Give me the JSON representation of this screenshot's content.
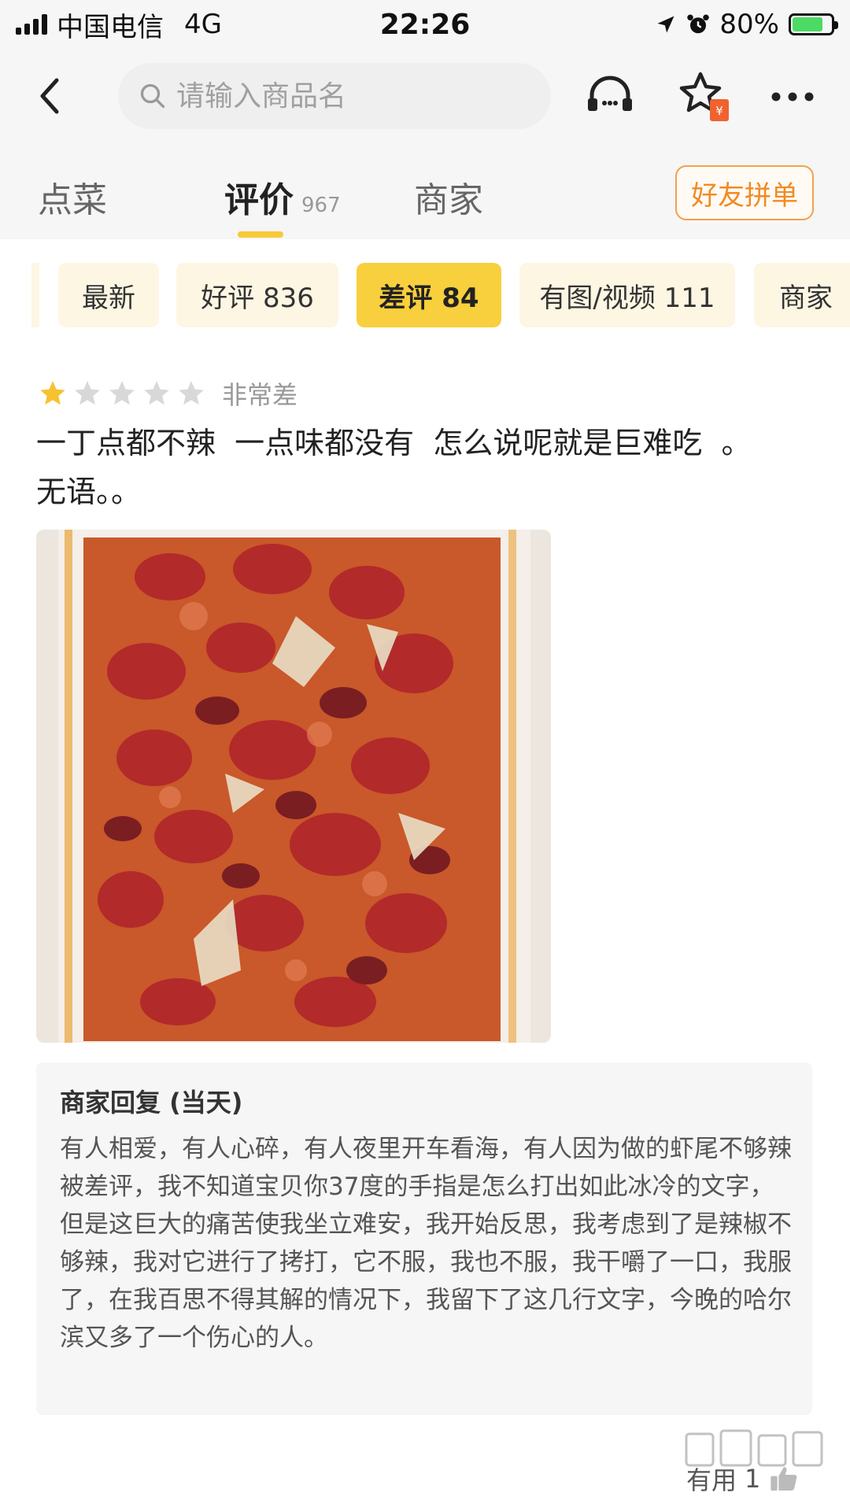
{
  "status_bar": {
    "carrier": "中国电信",
    "network": "4G",
    "time": "22:26",
    "battery": "80%"
  },
  "header": {
    "search_placeholder": "请输入商品名",
    "icons": [
      "back-arrow-icon",
      "search-icon",
      "customer-service-icon",
      "star-coupon-icon",
      "more-icon"
    ]
  },
  "tabs": {
    "order": "点菜",
    "reviews": "评价",
    "reviews_count": "967",
    "merchant": "商家",
    "group_order": "好友拼单"
  },
  "filters": [
    {
      "label": "最新"
    },
    {
      "label": "好评 836"
    },
    {
      "label": "差评 84"
    },
    {
      "label": "有图/视频 111"
    },
    {
      "label": "商家"
    }
  ],
  "review": {
    "stars": 1,
    "max_stars": 5,
    "rating_text": "非常差",
    "text": "一丁点都不辣  一点味都没有  怎么说呢就是巨难吃  。\n无语。。"
  },
  "reply": {
    "title": "商家回复 (当天)",
    "body": "有人相爱，有人心碎，有人夜里开车看海，有人因为做的虾尾不够辣被差评，我不知道宝贝你37度的手指是怎么打出如此冰冷的文字，但是这巨大的痛苦使我坐立难安，我开始反思，我考虑到了是辣椒不够辣，我对它进行了拷打，它不服，我也不服，我干嚼了一口，我服了，在我百思不得其解的情况下，我留下了这几行文字，今晚的哈尔滨又多了一个伤心的人。"
  },
  "footer": {
    "useful_label": "有用",
    "useful_count": "1"
  },
  "colors": {
    "accent_yellow": "#f8cf3d",
    "chip_bg": "#fdf6e3",
    "orange": "#f08a24",
    "star_gold": "#f7c230",
    "star_gray": "#d8d8d8"
  }
}
